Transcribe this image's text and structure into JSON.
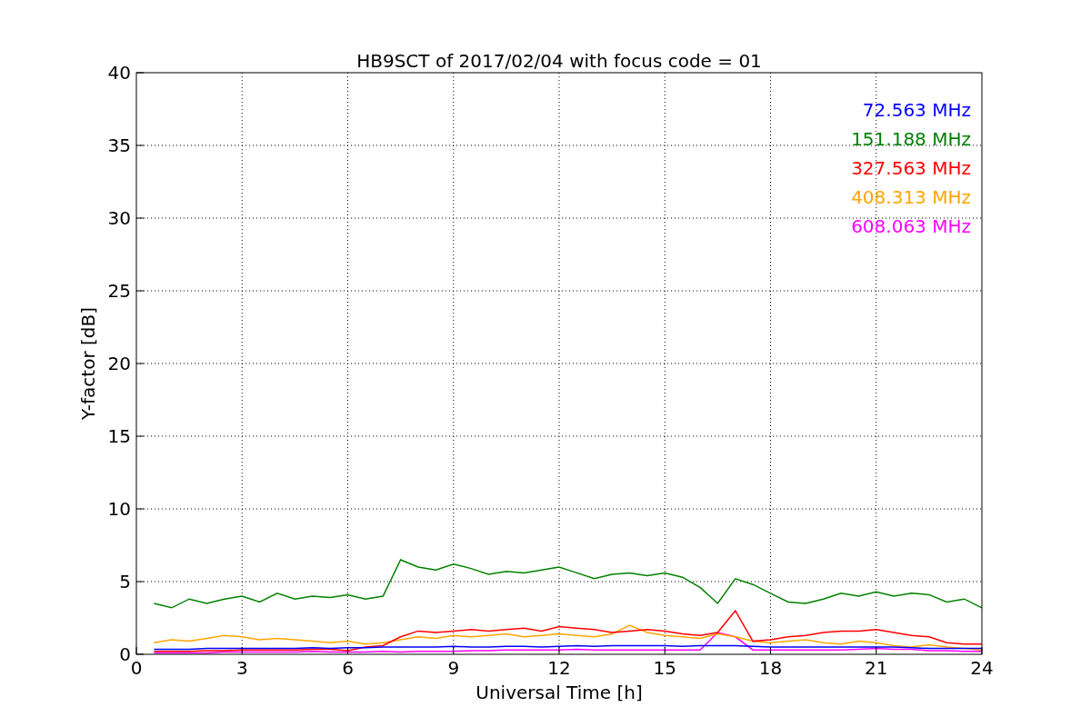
{
  "figure": {
    "chart_data": {
      "type": "line",
      "title": "HB9SCT of 2017/02/04 with focus code = 01",
      "xlabel": "Universal Time [h]",
      "ylabel": "Y-factor [dB]",
      "grid": true,
      "x": [
        0.5,
        1,
        1.5,
        2,
        2.5,
        3,
        3.5,
        4,
        4.5,
        5,
        5.5,
        6,
        6.5,
        7,
        7.5,
        8,
        8.5,
        9,
        9.5,
        10,
        10.5,
        11,
        11.5,
        12,
        12.5,
        13,
        13.5,
        14,
        14.5,
        15,
        15.5,
        16,
        16.5,
        17,
        17.5,
        18,
        18.5,
        19,
        19.5,
        20,
        20.5,
        21,
        21.5,
        22,
        22.5,
        23,
        23.5,
        24
      ],
      "xlim": [
        0,
        24
      ],
      "ylim": [
        0,
        40
      ],
      "xticks": [
        0,
        3,
        6,
        9,
        12,
        15,
        18,
        21,
        24
      ],
      "yticks": [
        0,
        5,
        10,
        15,
        20,
        25,
        30,
        35,
        40
      ],
      "series": [
        {
          "name": "72.563 MHz",
          "color": "#0000ff",
          "values": [
            0.35,
            0.35,
            0.35,
            0.4,
            0.4,
            0.4,
            0.4,
            0.4,
            0.4,
            0.45,
            0.4,
            0.45,
            0.45,
            0.5,
            0.5,
            0.5,
            0.5,
            0.55,
            0.5,
            0.5,
            0.55,
            0.55,
            0.5,
            0.55,
            0.6,
            0.55,
            0.6,
            0.6,
            0.6,
            0.6,
            0.55,
            0.6,
            0.6,
            0.6,
            0.55,
            0.5,
            0.5,
            0.5,
            0.5,
            0.5,
            0.5,
            0.5,
            0.5,
            0.45,
            0.4,
            0.4,
            0.4,
            0.4
          ]
        },
        {
          "name": "151.188 MHz",
          "color": "#008000",
          "values": [
            3.5,
            3.2,
            3.8,
            3.5,
            3.8,
            4.0,
            3.6,
            4.2,
            3.8,
            4.0,
            3.9,
            4.1,
            3.8,
            4.0,
            6.5,
            6.0,
            5.8,
            6.2,
            5.9,
            5.5,
            5.7,
            5.6,
            5.8,
            6.0,
            5.6,
            5.2,
            5.5,
            5.6,
            5.4,
            5.6,
            5.3,
            4.6,
            3.5,
            5.2,
            4.8,
            4.2,
            3.6,
            3.5,
            3.8,
            4.2,
            4.0,
            4.3,
            4.0,
            4.2,
            4.1,
            3.6,
            3.8,
            3.2
          ]
        },
        {
          "name": "327.563 MHz",
          "color": "#ff0000",
          "values": [
            0.2,
            0.2,
            0.2,
            0.25,
            0.25,
            0.3,
            0.3,
            0.3,
            0.3,
            0.35,
            0.35,
            0.25,
            0.5,
            0.6,
            1.2,
            1.6,
            1.5,
            1.6,
            1.7,
            1.6,
            1.7,
            1.8,
            1.6,
            1.9,
            1.8,
            1.7,
            1.5,
            1.6,
            1.7,
            1.6,
            1.4,
            1.3,
            1.5,
            3.0,
            0.9,
            1.0,
            1.2,
            1.3,
            1.5,
            1.6,
            1.6,
            1.7,
            1.5,
            1.3,
            1.2,
            0.8,
            0.7,
            0.7
          ]
        },
        {
          "name": "408.313 MHz",
          "color": "#ffa500",
          "values": [
            0.8,
            1.0,
            0.9,
            1.1,
            1.3,
            1.2,
            1.0,
            1.1,
            1.0,
            0.9,
            0.8,
            0.9,
            0.7,
            0.8,
            1.0,
            1.2,
            1.1,
            1.3,
            1.2,
            1.3,
            1.4,
            1.2,
            1.3,
            1.4,
            1.3,
            1.2,
            1.4,
            2.0,
            1.5,
            1.3,
            1.2,
            1.1,
            1.4,
            1.2,
            0.9,
            0.8,
            0.9,
            1.0,
            0.8,
            0.7,
            0.9,
            0.8,
            0.6,
            0.5,
            0.65,
            0.5,
            0.4,
            0.3
          ]
        },
        {
          "name": "608.063 MHz",
          "color": "#ff00ff",
          "values": [
            0.1,
            0.1,
            0.1,
            0.1,
            0.15,
            0.15,
            0.15,
            0.15,
            0.15,
            0.2,
            0.15,
            0.15,
            0.15,
            0.2,
            0.15,
            0.2,
            0.2,
            0.2,
            0.25,
            0.25,
            0.3,
            0.3,
            0.3,
            0.3,
            0.35,
            0.3,
            0.3,
            0.3,
            0.3,
            0.3,
            0.3,
            0.3,
            1.5,
            1.2,
            0.3,
            0.3,
            0.3,
            0.3,
            0.3,
            0.3,
            0.35,
            0.4,
            0.35,
            0.35,
            0.25,
            0.25,
            0.2,
            0.2
          ]
        }
      ]
    }
  }
}
